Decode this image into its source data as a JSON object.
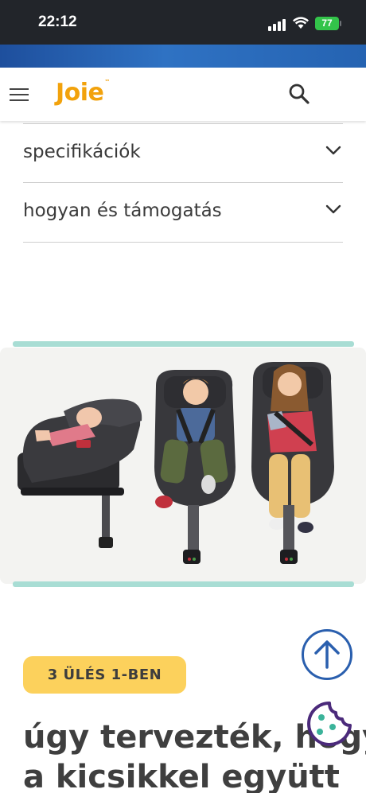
{
  "status_bar": {
    "time": "22:12",
    "battery": "77"
  },
  "header": {
    "logo_text": "Joie",
    "logo_tm": "™"
  },
  "accordion": [
    {
      "label": "specifikációk"
    },
    {
      "label": "hogyan és támogatás"
    }
  ],
  "product": {
    "badge": "3 ÜLÉS 1-BEN",
    "headline_line1": "úgy tervezték, hogy",
    "headline_line2": "a kicsikkel együtt"
  },
  "colors": {
    "brand": "#f2a20c",
    "status_bar": "#22252a",
    "blue_strip": "#2f72c3",
    "teal_accent": "#a8ddd4",
    "badge_bg": "#fcd15c",
    "scroll_button": "#2a5fae",
    "cookie_button": "#4b2a7b"
  },
  "icons": [
    "menu-icon",
    "search-icon",
    "chevron-down-icon",
    "arrow-up-icon",
    "cookie-icon",
    "signal-icon",
    "wifi-icon",
    "battery-icon"
  ]
}
